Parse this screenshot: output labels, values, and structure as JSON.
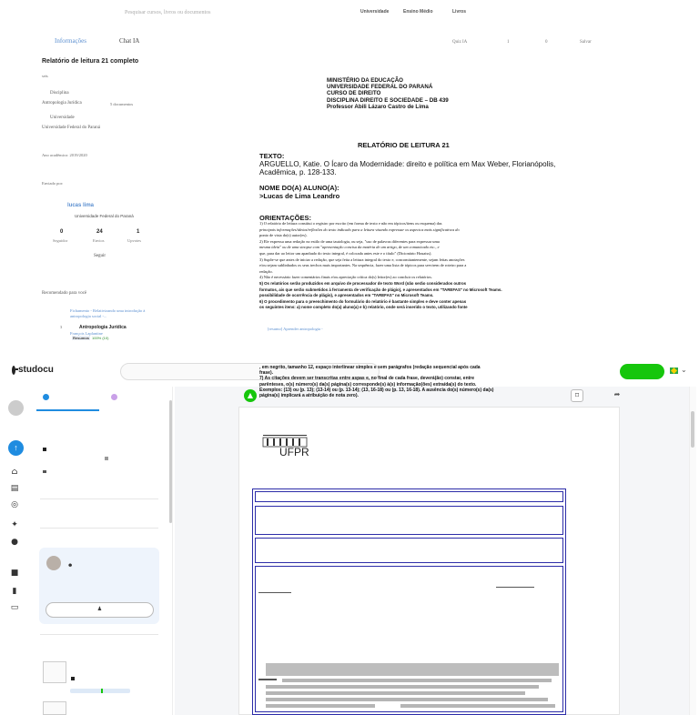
{
  "top": {
    "search_placeholder": "Pesquisar cursos, livros ou documentos",
    "nav": [
      "Universidade",
      "Ensino Médio",
      "Livros"
    ],
    "tabs": [
      "Informações",
      "Chat IA"
    ],
    "quiz_label": "Quiz IA",
    "like_count": "1",
    "dislike_count": "0",
    "save_label": "Salvar",
    "doc_title": "Relatório de leitura 21 completo",
    "doc_type": "seis",
    "discipline_label": "Disciplina",
    "discipline": "Antropologia Jurídica",
    "discipline_docs": "5 documentos",
    "university_label": "Universidade",
    "university": "Universidade Federal do Paraná",
    "academic_year": "Ano acadêmico: 2019/2020",
    "sent_by": "Enviado por:",
    "user_name": "lucas lima",
    "user_uni": "Universidade Federal do Paraná",
    "stats": [
      {
        "value": "0",
        "label": "Seguidor"
      },
      {
        "value": "24",
        "label": "Envios"
      },
      {
        "value": "1",
        "label": "Upvotes"
      }
    ],
    "follow": "Seguir",
    "recommended": "Recomendado para você",
    "rec_item_1": "Fichamento - Relativizando uma introdução à antropologia social -...",
    "rec_item_2_num": "3",
    "rec_item_2": "Antropologia Jurídica",
    "rec_item_2_author": "François Laplantine",
    "rec_item_2_badge": "Resumos",
    "rec_item_2_pct": "100% (10)",
    "rec_item_3": "[resumo] Aprender antropologia -"
  },
  "pdf": {
    "header_lines": [
      "MINISTÉRIO DA EDUCAÇÃO",
      "UNIVERSIDADE FEDERAL DO PARANÁ",
      "CURSO DE DIREITO",
      "DISCIPLINA DIREITO E SOCIEDADE – DB 439",
      "Professor Abili Lázaro Castro de Lima"
    ],
    "report_title": "RELATÓRIO DE LEITURA 21",
    "texto_label": "TEXTO:",
    "texto": "ARGUELLO, Katie. O Ícaro da Modernidade: direito e política em Max Weber, Florianópolis, Acadêmica, p. 128-133.",
    "nome_label": "NOME DO(A) ALUNO(A):",
    "nome": ">Lucas de Lima Leandro",
    "orient_label": "ORIENTAÇÕES:",
    "orient_lines": [
      "1) O relatório de leitura constitui o registro por escrito (em forma de texto e não em tópicos/itens ou esquema) das",
      "principais informações/ideias/reflexões do texto indicado para a leitura visando expressar os aspectos mais significativos do",
      "ponto de vista do(s) autor(es).",
      "2) Ele expressa uma redação no estilo de uma tautologia, ou seja, \"uso de palavras diferentes para expressar uma",
      "mesma ideia\" ou de uma sinopse com \"apresentação concisa da matéria de um artigo, de um comunicado etc., e",
      "que, para dar ao leitor um apanhado do texto integral, é colocada antes este e o título\" (Dicionário Houaiss).",
      "3) Supõe-se que antes de iniciar a redação, que seja feita a leitura integral do texto e, concomitantemente, sejam feitas anotações",
      "e/ou sejam sublinhados os seus trechos mais importantes. Na sequência, fazer uma lista de tópicos para servirem de roteiro para a",
      "redação.",
      "4) Não é necessário fazer comentários finais e/ou apreciação crítica do(s) leitor(es) ao concluir os relatórios.",
      "5) Os relatórios serão produzidos em arquivo de processador de texto Word (não serão considerados outros",
      "formatos, ais que serão submetidos à ferramenta de verificação de plágio), e apresentados em \"TAREFAS\" no Microsoft Teams.",
      "possibilidade de ocorrência de plágio), e apresentados em \"TAREFAS\" no Microsoft Teams.",
      "6) O procedimento para o preenchimento do formulário do relatório é bastante simples e deve conter apenas",
      "os seguintes itens: a) nome completo do(a) aluno(a) e b) relatório, onde será inserido o texto, utilizando fonte"
    ],
    "overlay_lines": [
      ", em negrito, tamanho 12, espaço interlinear simples e sem parágrafos (redação sequencial após cada",
      "frase).",
      "7) As citações devem ser transcritas entre aspas e, no final de cada frase, deverá(ão) constar, entre",
      "parênteses, o(s) número(s) da(s) página(s) corresponde(s) à(s) informação(ões) extraída(s) do texto.",
      "Exemplos: (13) ou (p. 13); (13-14) ou (p. 13-14); (13, 16-18) ou (p. 13, 16-18). A ausência do(s) número(s) da(s)",
      "página(s) implicará a atribuição de nota zero)."
    ]
  },
  "app": {
    "logo": "studocu",
    "ufpr": "UFPR",
    "card_icon": "☻",
    "follow_icon": "♟"
  },
  "colors": {
    "accent_blue": "#1f8ce0",
    "green": "#16c60c",
    "form_border": "#2c2ca8"
  }
}
